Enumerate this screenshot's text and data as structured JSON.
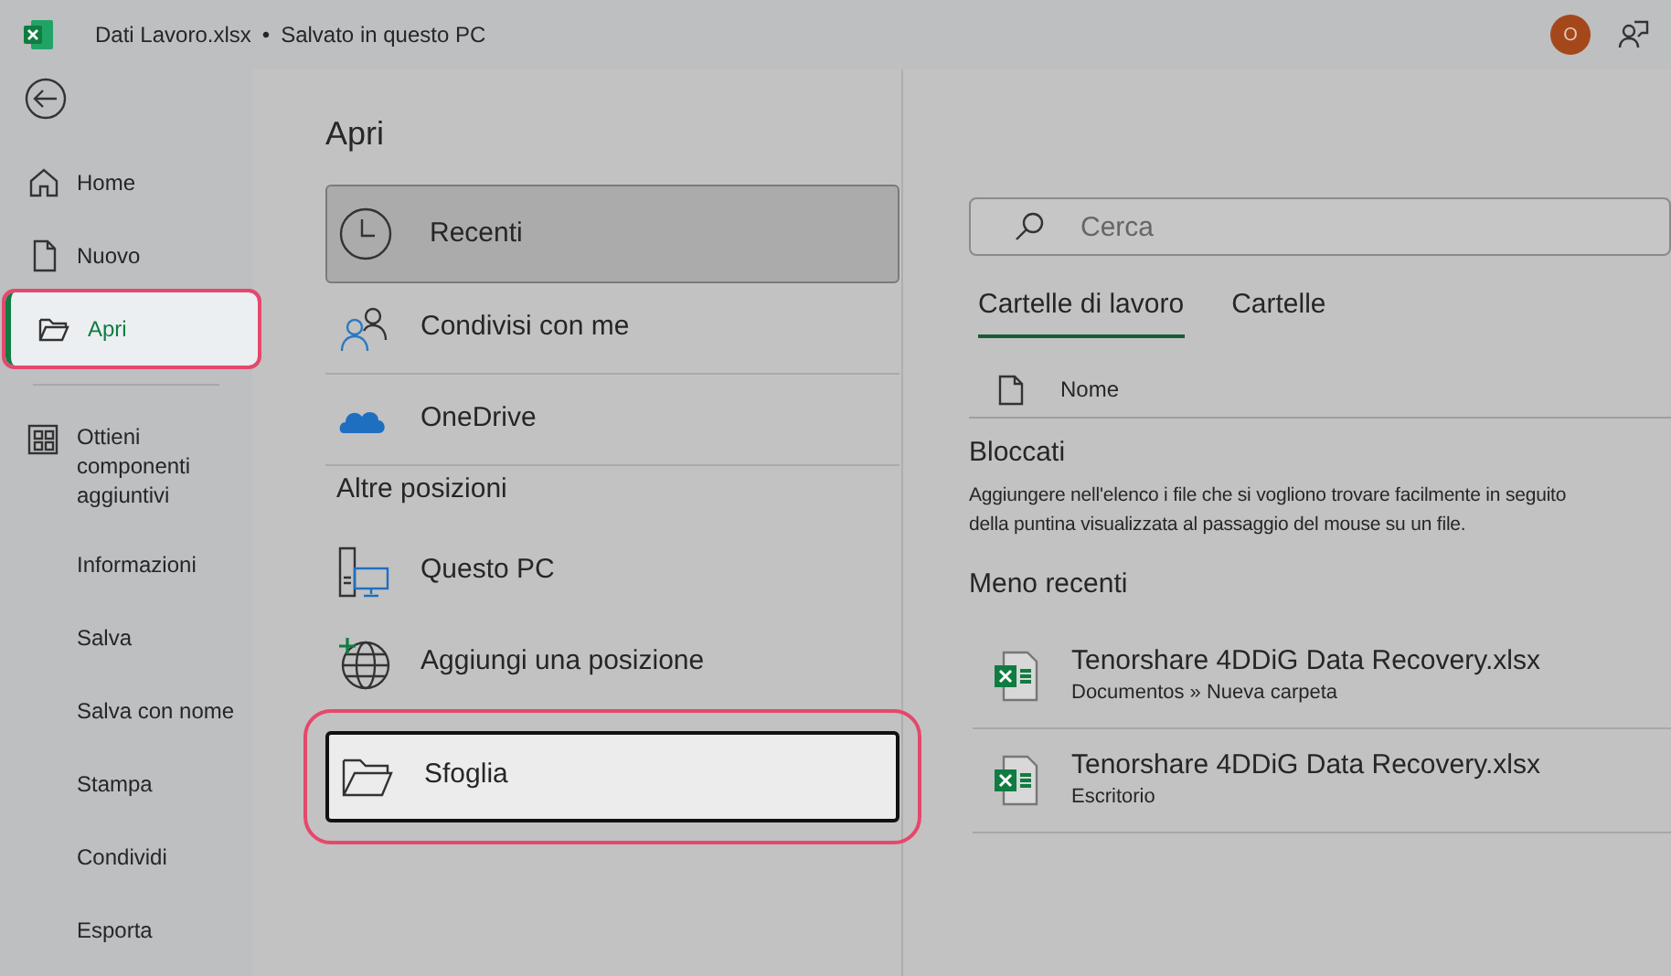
{
  "title_bar": {
    "file_name": "Dati Lavoro.xlsx",
    "separator": "•",
    "save_status": "Salvato in questo PC",
    "avatar_initial": "O"
  },
  "sidebar": {
    "items": [
      {
        "label": "Home",
        "selected": false,
        "highlighted": false
      },
      {
        "label": "Nuovo",
        "selected": false,
        "highlighted": false
      },
      {
        "label": "Apri",
        "selected": true,
        "highlighted": true
      },
      {
        "label": "Ottieni componenti aggiuntivi",
        "selected": false,
        "highlighted": false
      },
      {
        "label": "Informazioni",
        "selected": false,
        "highlighted": false
      },
      {
        "label": "Salva",
        "selected": false,
        "highlighted": false
      },
      {
        "label": "Salva con nome",
        "selected": false,
        "highlighted": false
      },
      {
        "label": "Stampa",
        "selected": false,
        "highlighted": false
      },
      {
        "label": "Condividi",
        "selected": false,
        "highlighted": false
      },
      {
        "label": "Esporta",
        "selected": false,
        "highlighted": false
      }
    ]
  },
  "page_title": "Apri",
  "locations": [
    {
      "kind": "item",
      "label": "Recenti",
      "selected": true,
      "highlighted": false
    },
    {
      "kind": "item",
      "label": "Condivisi con me",
      "selected": false,
      "highlighted": false
    },
    {
      "kind": "item",
      "label": "OneDrive",
      "selected": false,
      "highlighted": false
    },
    {
      "kind": "heading",
      "label": "Altre posizioni"
    },
    {
      "kind": "item",
      "label": "Questo PC",
      "selected": false,
      "highlighted": false
    },
    {
      "kind": "item",
      "label": "Aggiungi una posizione",
      "selected": false,
      "highlighted": false
    },
    {
      "kind": "item",
      "label": "Sfoglia",
      "selected": false,
      "highlighted": true
    }
  ],
  "search": {
    "placeholder": "Cerca"
  },
  "tabs": [
    {
      "label": "Cartelle di lavoro",
      "selected": true
    },
    {
      "label": "Cartelle",
      "selected": false
    }
  ],
  "column_header": "Nome",
  "pinned": {
    "heading": "Bloccati",
    "lines": [
      "Aggiungere nell'elenco i file che si vogliono trovare facilmente in seguito",
      "della puntina visualizzata al passaggio del mouse su un file."
    ]
  },
  "older": {
    "heading": "Meno recenti",
    "files": [
      {
        "name": "Tenorshare 4DDiG Data Recovery.xlsx",
        "path": "Documentos » Nueva carpeta"
      },
      {
        "name": "Tenorshare 4DDiG Data Recovery.xlsx",
        "path": "Escritorio"
      }
    ]
  }
}
